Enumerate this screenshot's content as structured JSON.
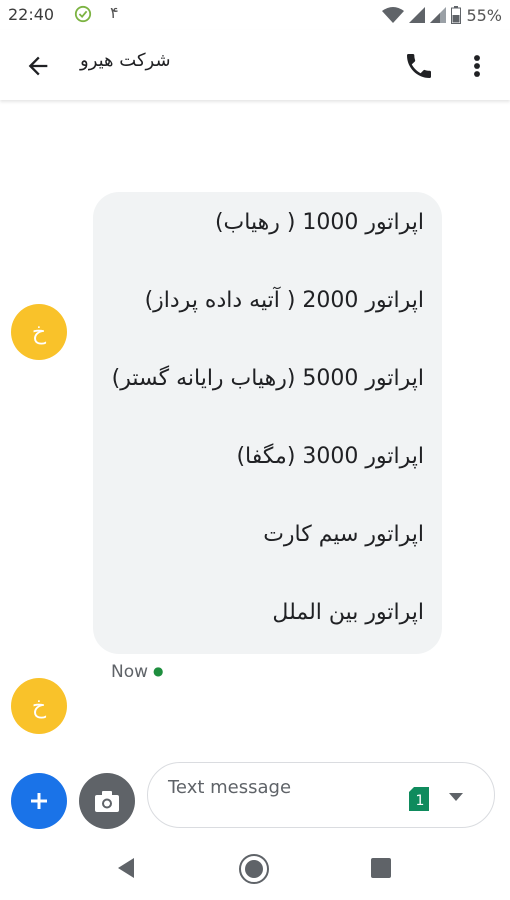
{
  "status_bar": {
    "time": "22:40",
    "notification_text": "۴",
    "battery_percent": "55%"
  },
  "app_bar": {
    "title": "شرکت هیرو"
  },
  "conversation": {
    "avatar_letter": "خ",
    "avatar_color": "#f9c22a",
    "message_lines": [
      "اپراتور 1000 ( رهیاب)",
      "اپراتور 2000 ( آتیه داده پرداز)",
      "اپراتور 5000 (رهیاب رایانه گستر)",
      "اپراتور 3000 (مگفا)",
      "اپراتور سیم کارت",
      "اپراتور بین الملل"
    ],
    "timestamp": "Now"
  },
  "compose": {
    "placeholder": "Text message",
    "sim_number": "1"
  },
  "colors": {
    "accent_blue": "#1a73e8",
    "bubble_bg": "#f1f3f4",
    "sim_green": "#0f8b5d"
  }
}
